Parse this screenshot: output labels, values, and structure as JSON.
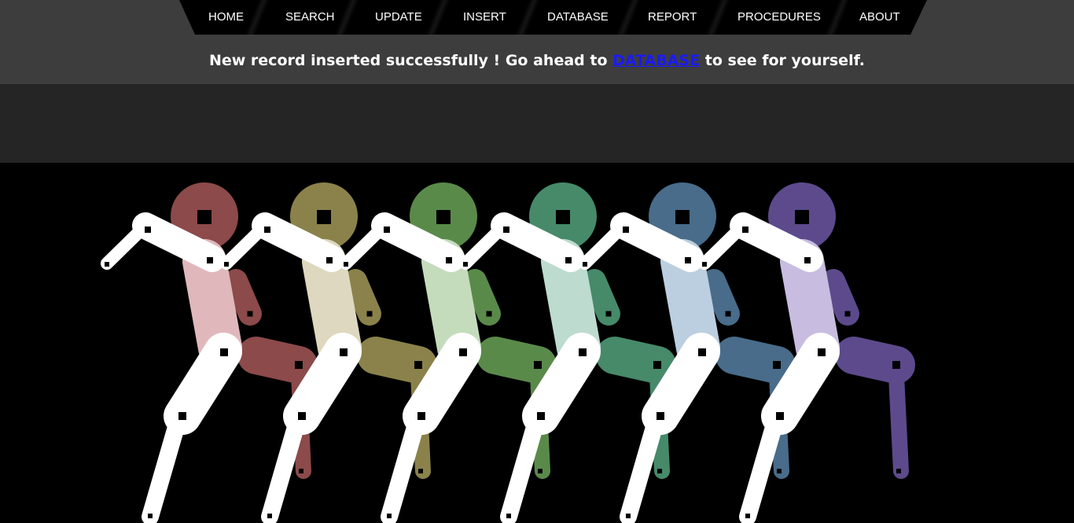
{
  "nav": {
    "items": [
      "HOME",
      "SEARCH",
      "UPDATE",
      "INSERT",
      "DATABASE",
      "REPORT",
      "PROCEDURES",
      "ABOUT"
    ]
  },
  "message": {
    "before": "New record inserted successfully ! Go ahead to ",
    "link": "DATABASE",
    "after": " to see for yourself."
  },
  "colors": {
    "top_band": "#3d3d3d",
    "mid_band": "#252525",
    "stage": "#000000",
    "nav_bg": "#000000",
    "link": "#1a1aff",
    "arm": "#ffffff"
  },
  "robots": [
    {
      "head": "#8c4a4a",
      "torso": "#e0b8bc",
      "leg": "#8c4a4a"
    },
    {
      "head": "#8a824a",
      "torso": "#ddd8bf",
      "leg": "#8a824a"
    },
    {
      "head": "#5a8a4a",
      "torso": "#c4dcbc",
      "leg": "#5a8a4a"
    },
    {
      "head": "#468a6a",
      "torso": "#bedbd0",
      "leg": "#468a6a"
    },
    {
      "head": "#486c8a",
      "torso": "#bccfe0",
      "leg": "#486c8a"
    },
    {
      "head": "#5c4a8c",
      "torso": "#c8bde0",
      "leg": "#5c4a8c"
    }
  ]
}
